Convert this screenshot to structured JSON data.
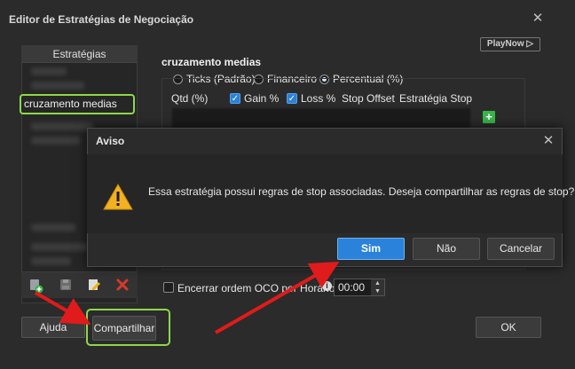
{
  "window": {
    "title": "Editor de Estratégias de Negociação",
    "close": "✕"
  },
  "strategies": {
    "header": "Estratégias",
    "selected": "cruzamento medias"
  },
  "playnow": "PlayNow ▷",
  "strategy": {
    "name": "cruzamento medias",
    "modes": [
      {
        "label": "Ticks (Padrão)",
        "selected": false
      },
      {
        "label": "Financeiro",
        "selected": false
      },
      {
        "label": "Percentual (%)",
        "selected": true
      }
    ],
    "columns": {
      "qtd": "Qtd (%)",
      "gain": "Gain %",
      "loss": "Loss %",
      "stop_offset": "Stop Offset",
      "estrategia_stop": "Estratégia Stop"
    },
    "oco_label": "Encerrar ordem OCO por Horário",
    "oco_time": "00:00"
  },
  "buttons": {
    "ajuda": "Ajuda",
    "compartilhar": "Compartilhar",
    "ok": "OK"
  },
  "dialog": {
    "title": "Aviso",
    "close": "✕",
    "message": "Essa estratégia possui regras de stop associadas. Deseja compartilhar as regras de stop?",
    "sim": "Sim",
    "nao": "Não",
    "cancelar": "Cancelar"
  },
  "colors": {
    "accent_blue": "#2a82da",
    "highlight_green": "#8ed84a",
    "arrow_red": "#e01b1b"
  }
}
